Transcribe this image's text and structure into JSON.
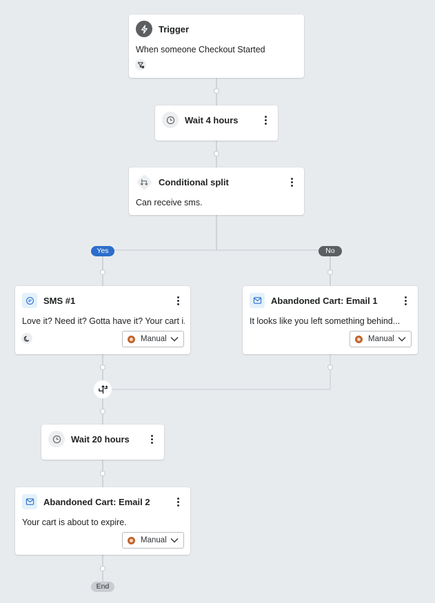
{
  "flow": {
    "trigger": {
      "icon": "lightning-icon",
      "title": "Trigger",
      "description": "When someone Checkout Started",
      "filter_icon": "filter-icon"
    },
    "wait_1": {
      "icon": "clock-icon",
      "title": "Wait 4 hours"
    },
    "conditional_split": {
      "icon": "split-icon",
      "title": "Conditional split",
      "description": "Can receive sms."
    },
    "branches": {
      "yes_label": "Yes",
      "no_label": "No",
      "colors": {
        "yes": "#2c6ecb",
        "no": "#5c5f62"
      }
    },
    "sms_1": {
      "icon": "sms-icon",
      "title": "SMS #1",
      "description": "Love it? Need it? Gotta have it? Your cart i...",
      "quiet_hours_icon": "moon-icon",
      "status": "Manual"
    },
    "email_1": {
      "icon": "email-icon",
      "title": "Abandoned Cart: Email 1",
      "description": "It looks like you left something behind...",
      "status": "Manual"
    },
    "merge": {
      "icon": "merge-icon"
    },
    "wait_2": {
      "icon": "clock-icon",
      "title": "Wait 20 hours"
    },
    "email_2": {
      "icon": "email-icon",
      "title": "Abandoned Cart: Email 2",
      "description": "Your cart is about to expire.",
      "status": "Manual"
    },
    "end_label": "End"
  },
  "colors": {
    "canvas": "#e8ebee",
    "card": "#ffffff",
    "connector": "#cfd3d8",
    "manual_status": "#c1642d"
  }
}
